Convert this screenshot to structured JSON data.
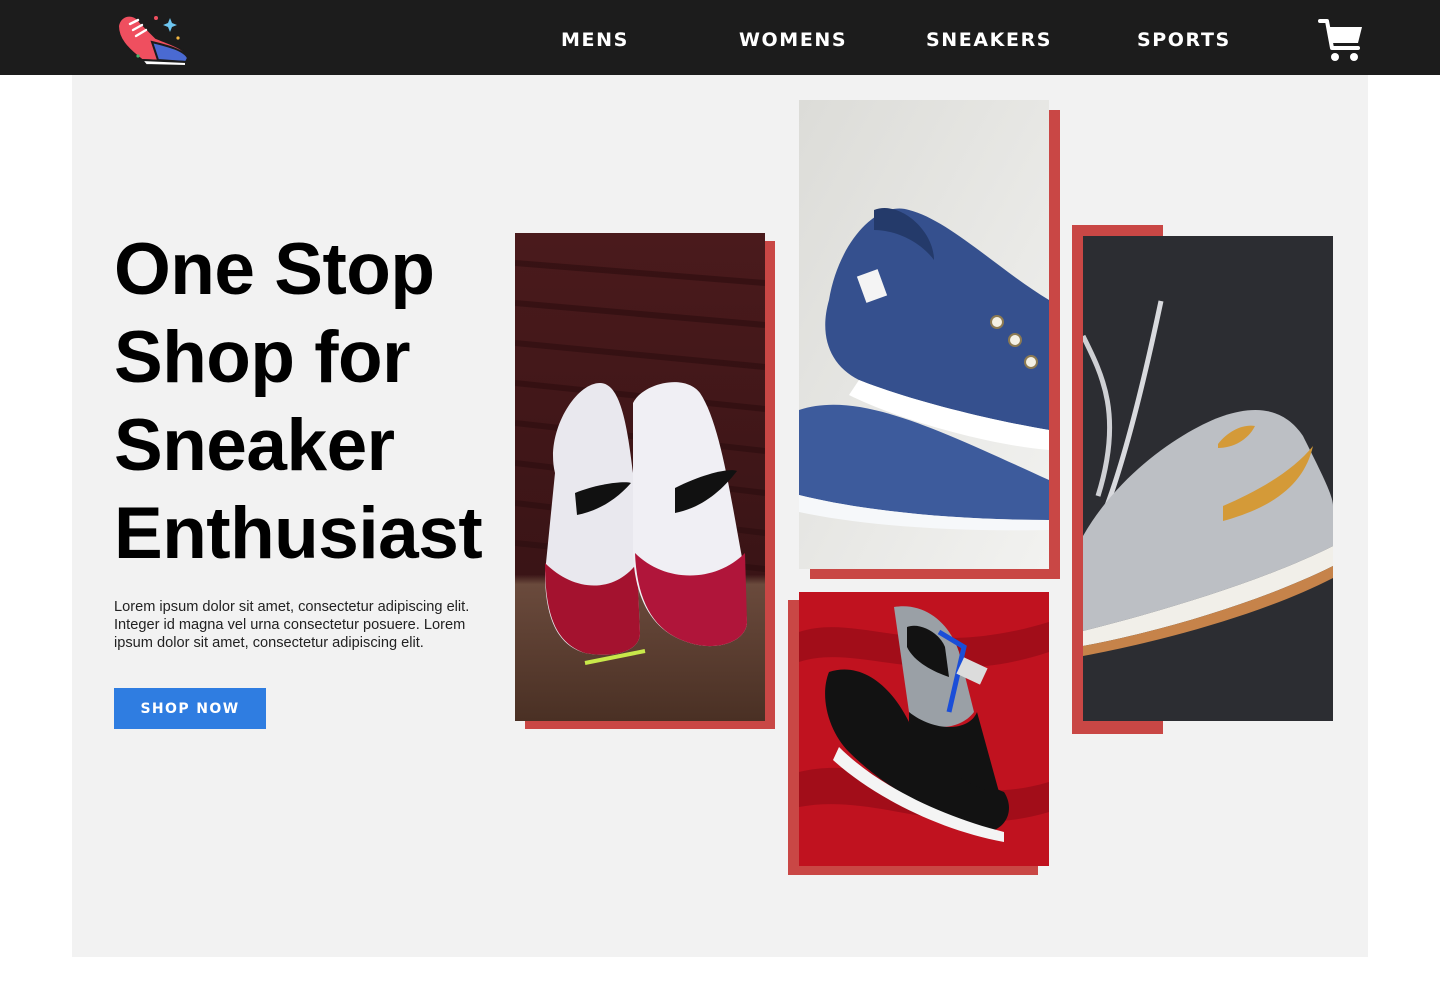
{
  "brand": {
    "logo_icon": "sneaker-logo-icon"
  },
  "nav": {
    "items": [
      {
        "label": "MENS"
      },
      {
        "label": "WOMENS"
      },
      {
        "label": "SNEAKERS"
      },
      {
        "label": "SPORTS"
      }
    ],
    "cart_icon": "shopping-cart-icon"
  },
  "hero": {
    "headline_lines": [
      "One Stop",
      "Shop for",
      "Sneaker",
      "Enthusiast"
    ],
    "body": "Lorem ipsum dolor sit amet, consectetur adipiscing elit. Integer id magna vel urna consectetur posuere. Lorem ipsum dolor sit amet, consectetur adipiscing elit.",
    "cta_label": "SHOP NOW"
  },
  "gallery": [
    {
      "subject": "white and red sneakers on a dark red background"
    },
    {
      "subject": "blue canvas sneakers on a light background"
    },
    {
      "subject": "black and grey high-top sneaker on red satin"
    },
    {
      "subject": "grey high-top sneaker with an orange swoosh on a dark background"
    }
  ],
  "colors": {
    "topbar": "#1c1c1c",
    "panel": "#f2f2f2",
    "accent_frame": "#c94745",
    "cta": "#2f7de1",
    "text": "#000000"
  }
}
